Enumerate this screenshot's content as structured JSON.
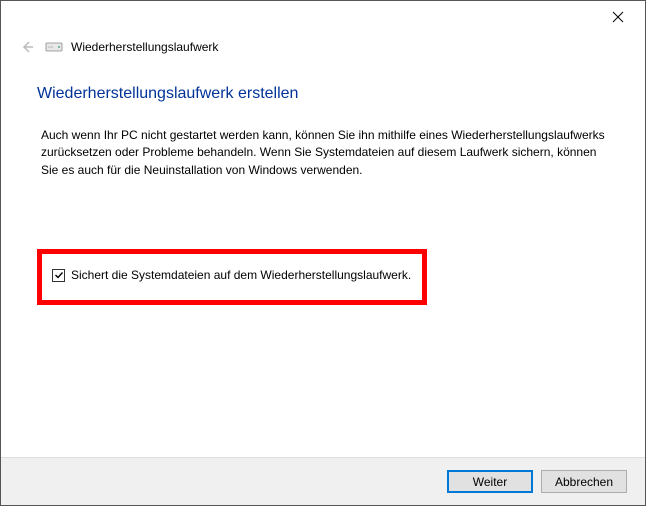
{
  "window": {
    "header_title": "Wiederherstellungslaufwerk"
  },
  "main": {
    "heading": "Wiederherstellungslaufwerk erstellen",
    "description": "Auch wenn Ihr PC nicht gestartet werden kann, können Sie ihn mithilfe eines Wiederherstellungslaufwerks zurücksetzen oder Probleme behandeln. Wenn Sie Systemdateien auf diesem Laufwerk sichern, können Sie es auch für die Neuinstallation von Windows verwenden."
  },
  "checkbox": {
    "label": "Sichert die Systemdateien auf dem Wiederherstellungslaufwerk.",
    "checked": true
  },
  "footer": {
    "next": "Weiter",
    "cancel": "Abbrechen"
  }
}
